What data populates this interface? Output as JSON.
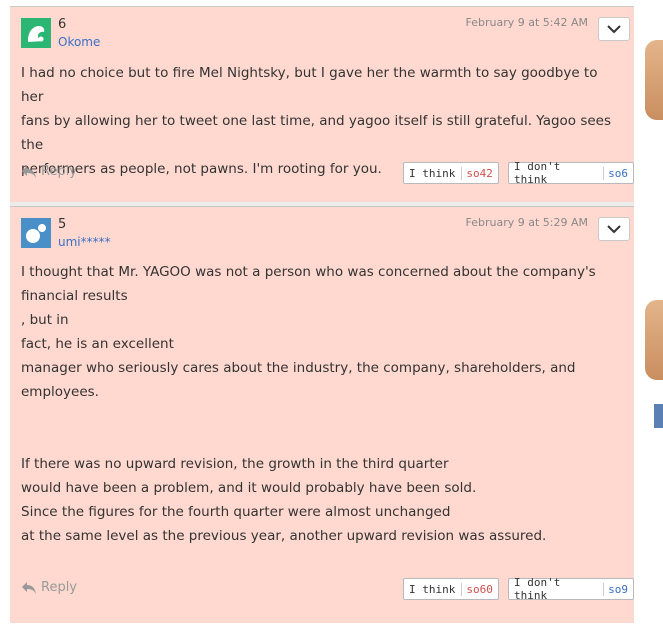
{
  "comments": [
    {
      "number": "6",
      "username": "Okome",
      "date": "February 9 at 5:42 AM",
      "body_lines": [
        "I had no choice but to fire Mel Nightsky, but I gave her the warmth to say goodbye to her",
        "fans by allowing her to tweet one last time, and yagoo itself is still grateful. Yagoo sees the",
        "performers as people, not pawns. I'm rooting for you."
      ],
      "reply_label": "Reply",
      "think_label": "I think",
      "think_count": "so42",
      "dont_think_label": "I don't think",
      "dont_think_count": "so6"
    },
    {
      "number": "5",
      "username": "umi*****",
      "date": "February 9 at 5:29 AM",
      "body_lines": [
        "I thought that Mr. YAGOO was not a person who was concerned about the company's",
        "financial results",
        ", but in",
        "fact, he is an excellent",
        "manager who seriously cares about the industry, the company, shareholders, and",
        "employees.",
        "",
        "",
        "If there was no upward revision, the growth in the third quarter",
        "would have been a problem, and it would probably have been sold.",
        "Since the figures for the fourth quarter were almost unchanged",
        "at the same level as the previous year, another upward revision was assured."
      ],
      "reply_label": "Reply",
      "think_label": "I think",
      "think_count": "so60",
      "dont_think_label": "I don't think",
      "dont_think_count": "so9"
    }
  ],
  "colors": {
    "comment_bg": "#ffd9cf",
    "username": "#3a6fc4",
    "think_count": "#d2504a",
    "dont_think_count": "#3a6fc4"
  }
}
